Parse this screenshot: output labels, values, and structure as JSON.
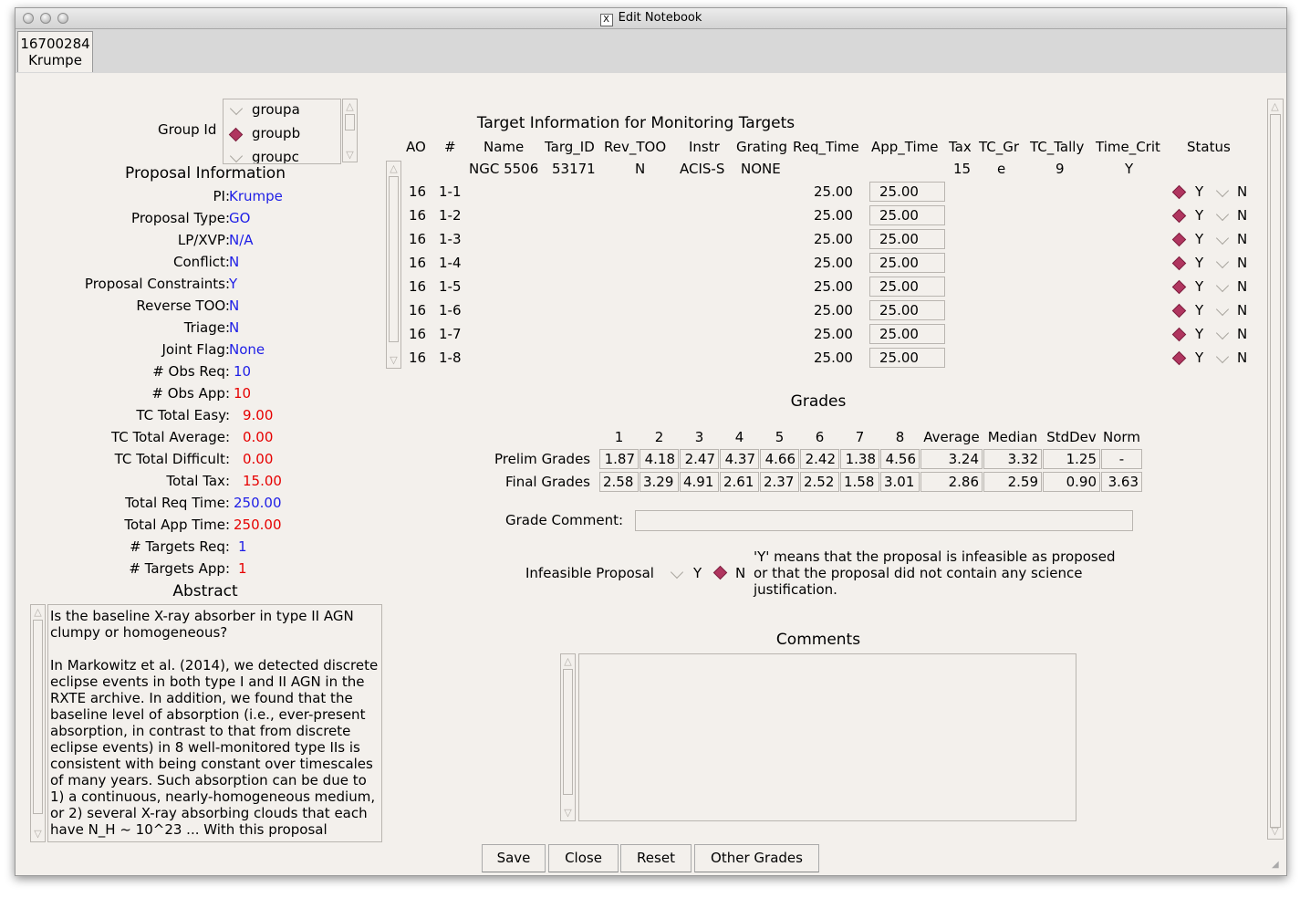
{
  "window": {
    "title": "Edit Notebook",
    "x_icon": "X"
  },
  "tab": {
    "line1": "16700284",
    "line2": "Krumpe"
  },
  "group": {
    "label": "Group Id",
    "options": [
      "groupa",
      "groupb",
      "groupc"
    ],
    "selected": "groupb"
  },
  "proposal": {
    "heading": "Proposal Information",
    "fields": [
      {
        "label": "PI:",
        "value": "Krumpe",
        "color": "#1e1ee6"
      },
      {
        "label": "Proposal Type:",
        "value": "GO",
        "color": "#1e1ee6"
      },
      {
        "label": "LP/XVP:",
        "value": "N/A",
        "color": "#1e1ee6"
      },
      {
        "label": "Conflict:",
        "value": "N",
        "color": "#1e1ee6"
      },
      {
        "label": "Proposal Constraints:",
        "value": "Y",
        "color": "#1e1ee6"
      },
      {
        "label": "Reverse TOO:",
        "value": "N",
        "color": "#1e1ee6"
      },
      {
        "label": "Triage:",
        "value": "N",
        "color": "#1e1ee6"
      },
      {
        "label": "Joint Flag:",
        "value": "None",
        "color": "#1e1ee6"
      },
      {
        "label": "# Obs Req:",
        "value": "10",
        "color": "#1e1ee6"
      },
      {
        "label": "# Obs App:",
        "value": "10",
        "color": "#e60000"
      },
      {
        "label": "TC Total Easy:",
        "value": "9.00",
        "color": "#e60000"
      },
      {
        "label": "TC Total Average:",
        "value": "0.00",
        "color": "#e60000"
      },
      {
        "label": "TC Total Difficult:",
        "value": "0.00",
        "color": "#e60000"
      },
      {
        "label": "Total Tax:",
        "value": "15.00",
        "color": "#e60000"
      },
      {
        "label": "Total Req Time:",
        "value": "250.00",
        "color": "#1e1ee6"
      },
      {
        "label": "Total App Time:",
        "value": "250.00",
        "color": "#e60000"
      },
      {
        "label": "# Targets Req:",
        "value": "1",
        "color": "#1e1ee6"
      },
      {
        "label": "# Targets App:",
        "value": "1",
        "color": "#e60000"
      }
    ]
  },
  "abstract": {
    "heading": "Abstract",
    "text": "Is the baseline X-ray absorber in type II AGN clumpy or homogeneous?\n\nIn Markowitz et al. (2014), we detected discrete eclipse events in both type I and II AGN in the RXTE archive. In addition, we found that the baseline level of absorption (i.e., ever-present absorption, in contrast to that from discrete eclipse events) in 8 well-monitored type IIs is consistent with being constant over timescales of many years. Such absorption can be due to 1) a continuous, nearly-homogeneous medium, or 2) several X-ray absorbing clouds that each have N_H ~ 10^23 ... With this proposal"
  },
  "targets": {
    "heading": "Target Information for Monitoring Targets",
    "columns": [
      "AO",
      "#",
      "Name",
      "Targ_ID",
      "Rev_TOO",
      "Instr",
      "Grating",
      "Req_Time",
      "App_Time",
      "Tax",
      "TC_Gr",
      "TC_Tally",
      "Time_Crit",
      "Status"
    ],
    "summary": {
      "name": "NGC 5506",
      "targ_id": "53171",
      "rev_too": "N",
      "instr": "ACIS-S",
      "grating": "NONE",
      "tax": "15",
      "tc_gr": "e",
      "tc_tally": "9",
      "time_crit": "Y"
    },
    "rows": [
      {
        "ao": "16",
        "num": "1-1",
        "req": "25.00",
        "app": "25.00",
        "status": "Y"
      },
      {
        "ao": "16",
        "num": "1-2",
        "req": "25.00",
        "app": "25.00",
        "status": "Y"
      },
      {
        "ao": "16",
        "num": "1-3",
        "req": "25.00",
        "app": "25.00",
        "status": "Y"
      },
      {
        "ao": "16",
        "num": "1-4",
        "req": "25.00",
        "app": "25.00",
        "status": "Y"
      },
      {
        "ao": "16",
        "num": "1-5",
        "req": "25.00",
        "app": "25.00",
        "status": "Y"
      },
      {
        "ao": "16",
        "num": "1-6",
        "req": "25.00",
        "app": "25.00",
        "status": "Y"
      },
      {
        "ao": "16",
        "num": "1-7",
        "req": "25.00",
        "app": "25.00",
        "status": "Y"
      },
      {
        "ao": "16",
        "num": "1-8",
        "req": "25.00",
        "app": "25.00",
        "status": "Y"
      }
    ],
    "status_yes": "Y",
    "status_no": "N"
  },
  "grades": {
    "heading": "Grades",
    "columns": [
      "1",
      "2",
      "3",
      "4",
      "5",
      "6",
      "7",
      "8",
      "Average",
      "Median",
      "StdDev",
      "Norm"
    ],
    "prelim_label": "Prelim Grades",
    "prelim": [
      "1.87",
      "4.18",
      "2.47",
      "4.37",
      "4.66",
      "2.42",
      "1.38",
      "4.56",
      "3.24",
      "3.32",
      "1.25",
      "-"
    ],
    "final_label": "Final Grades",
    "final": [
      "2.58",
      "3.29",
      "4.91",
      "2.61",
      "2.37",
      "2.52",
      "1.58",
      "3.01",
      "2.86",
      "2.59",
      "0.90",
      "3.63"
    ],
    "comment_label": "Grade Comment:",
    "comment_value": ""
  },
  "infeasible": {
    "label": "Infeasible Proposal",
    "yes": "Y",
    "no": "N",
    "selected": "N",
    "note": "'Y' means that the proposal is infeasible as proposed or that the proposal did not contain any science justification."
  },
  "comments": {
    "heading": "Comments",
    "value": ""
  },
  "buttons": {
    "save": "Save",
    "close": "Close",
    "reset": "Reset",
    "other": "Other Grades"
  },
  "colors": {
    "accent_radio": "#b0355f",
    "req_value": "#1e1ee6",
    "app_value": "#e60000",
    "background": "#f3f0ec"
  }
}
